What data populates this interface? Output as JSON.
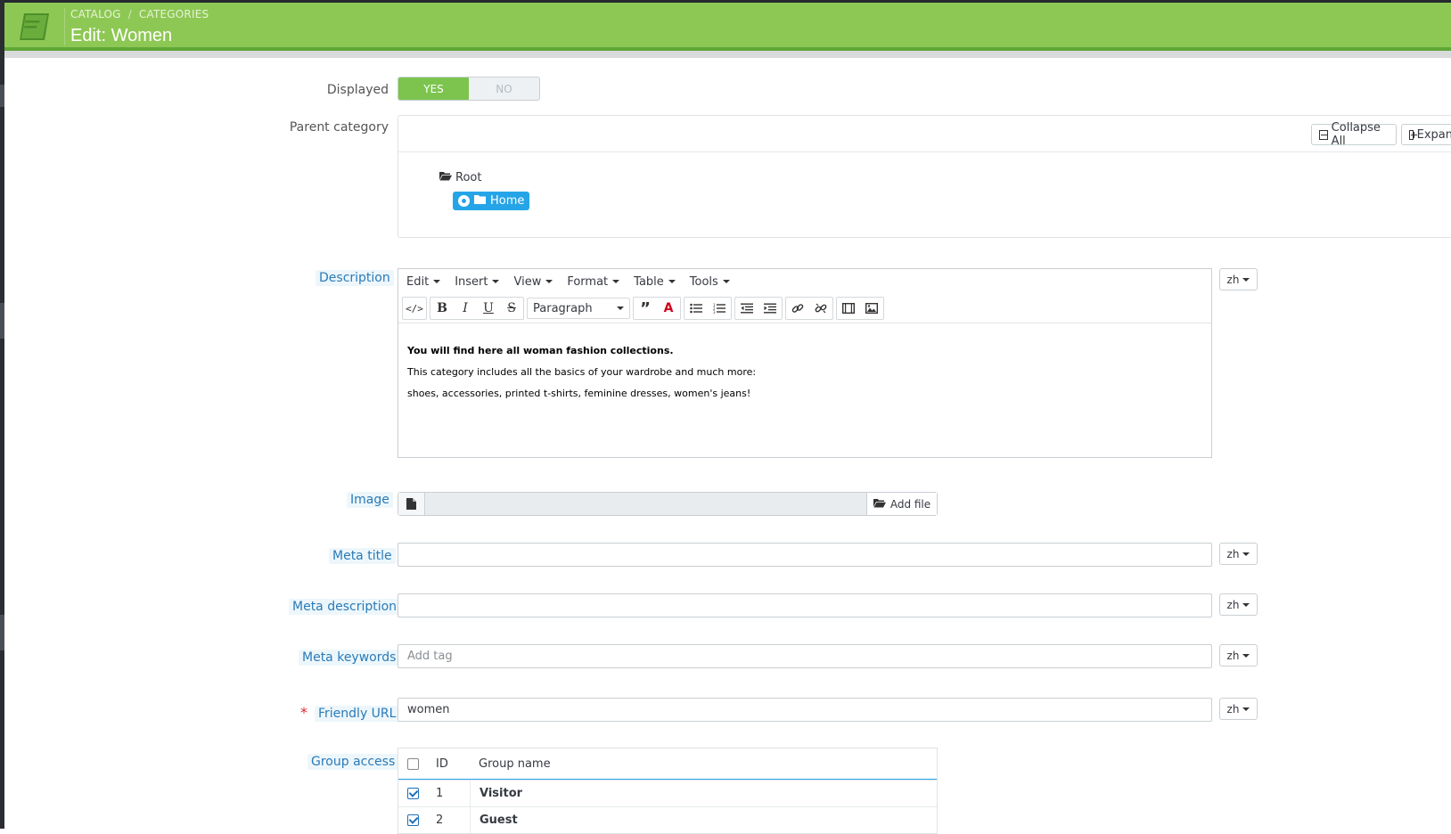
{
  "header": {
    "breadcrumb": [
      "CATALOG",
      "CATEGORIES"
    ],
    "breadcrumb_sep": "/",
    "title": "Edit: Women",
    "color": "#8ec854"
  },
  "form": {
    "displayed": {
      "label": "Displayed",
      "yes": "YES",
      "no": "NO",
      "value": "YES"
    },
    "parent_category": {
      "label": "Parent category",
      "collapse_all": "Collapse All",
      "expand_all": "Expan",
      "tree": {
        "root": "Root",
        "selected": "Home"
      }
    },
    "description": {
      "label": "Description",
      "menus": [
        "Edit",
        "Insert",
        "View",
        "Format",
        "Table",
        "Tools"
      ],
      "block_format": "Paragraph",
      "content": [
        "You will find here all woman fashion collections.",
        "This category includes all the basics of your wardrobe and much more:",
        "shoes, accessories, printed t-shirts, feminine dresses, women's jeans!"
      ],
      "lang": "zh"
    },
    "image": {
      "label": "Image",
      "add_file": "Add file"
    },
    "meta_title": {
      "label": "Meta title",
      "value": "",
      "lang": "zh"
    },
    "meta_description": {
      "label": "Meta description",
      "value": "",
      "lang": "zh"
    },
    "meta_keywords": {
      "label": "Meta keywords",
      "placeholder": "Add tag",
      "lang": "zh"
    },
    "friendly_url": {
      "label": "Friendly URL",
      "required": "*",
      "value": "women",
      "lang": "zh"
    },
    "group_access": {
      "label": "Group access",
      "columns": [
        "ID",
        "Group name"
      ],
      "rows": [
        {
          "id": "1",
          "name": "Visitor",
          "checked": true
        },
        {
          "id": "2",
          "name": "Guest",
          "checked": true
        }
      ]
    }
  }
}
